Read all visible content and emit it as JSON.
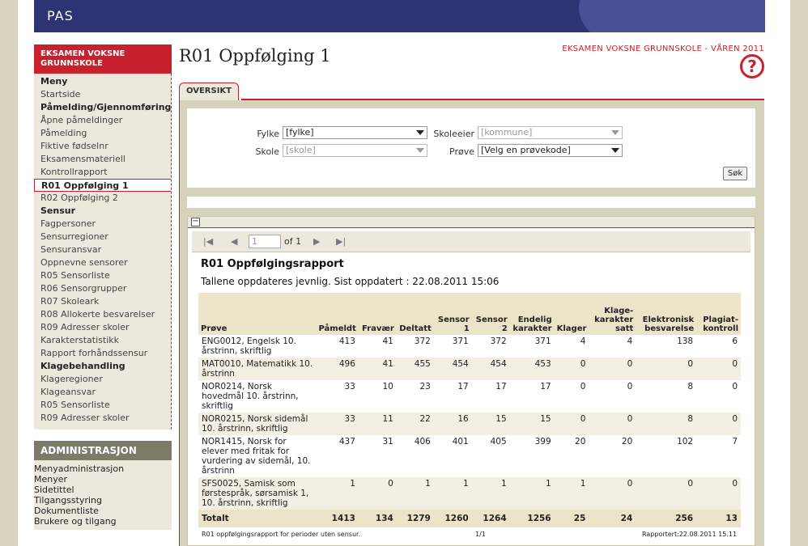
{
  "app": {
    "logo": "PAS"
  },
  "sidebar": {
    "header": "EKSAMEN VOKSNE GRUNNSKOLE",
    "items": [
      {
        "label": "Meny",
        "section": true
      },
      {
        "label": "Startside"
      },
      {
        "label": "Påmelding/Gjennomføring",
        "section": true
      },
      {
        "label": "Åpne påmeldinger"
      },
      {
        "label": "Påmelding"
      },
      {
        "label": "Fiktive fødselnr"
      },
      {
        "label": "Eksamensmateriell"
      },
      {
        "label": "Kontrollrapport"
      },
      {
        "label": "R01 Oppfølging 1",
        "active": true
      },
      {
        "label": "R02 Oppfølging 2"
      },
      {
        "label": "Sensur",
        "section": true
      },
      {
        "label": "Fagpersoner"
      },
      {
        "label": "Sensurregioner"
      },
      {
        "label": "Sensuransvar"
      },
      {
        "label": "Oppnevne sensorer"
      },
      {
        "label": "R05 Sensorliste"
      },
      {
        "label": "R06 Sensorgrupper"
      },
      {
        "label": "R07 Skoleark"
      },
      {
        "label": "R08 Allokerte besvarelser"
      },
      {
        "label": "R09 Adresser skoler"
      },
      {
        "label": "Karakterstatistikk"
      },
      {
        "label": "Rapport forhåndssensur"
      },
      {
        "label": "Klagebehandling",
        "section": true
      },
      {
        "label": "Klageregioner"
      },
      {
        "label": "Klageansvar"
      },
      {
        "label": "R05 Sensorliste"
      },
      {
        "label": "R09 Adresser skoler"
      }
    ],
    "admin_header": "ADMINISTRASJON",
    "admin_items": [
      {
        "label": "Menyadministrasjon",
        "section": true
      },
      {
        "label": "Menyer"
      },
      {
        "label": "Sidetittel"
      },
      {
        "label": "Tilgangsstyring"
      },
      {
        "label": "Dokumentliste"
      },
      {
        "label": "Brukere og tilgang",
        "section": true
      }
    ]
  },
  "page": {
    "title": "R01 Oppfølging 1",
    "exam_label": "EKSAMEN VOKSNE GRUNNSKOLE - VÅREN 2011",
    "help": "?",
    "tab": "OVERSIKT"
  },
  "filters": {
    "fylke_label": "Fylke",
    "fylke_value": "[fylke]",
    "skoleeier_label": "Skoleeier",
    "skoleeier_value": "[kommune]",
    "skole_label": "Skole",
    "skole_value": "[skole]",
    "prove_label": "Prøve",
    "prove_value": "[Velg en prøvekode]",
    "search_button": "Søk"
  },
  "report_toolbar": {
    "first": "|◀",
    "prev": "◀",
    "page_value": "1",
    "of_label": "of 1",
    "next": "▶",
    "last": "▶|",
    "collapse": "−"
  },
  "report": {
    "title": "R01 Oppfølgingsrapport",
    "subtitle": "Tallene oppdateres jevnlig. Sist oppdatert : 22.08.2011 15:06",
    "columns": [
      "Prøve",
      "Påmeldt",
      "Fravær",
      "Deltatt",
      "Sensor 1",
      "Sensor 2",
      "Endelig karakter",
      "Klager",
      "Klage-karakter satt",
      "Elektronisk besvarelse",
      "Plagiat-kontroll"
    ],
    "rows": [
      [
        "ENG0012, Engelsk 10. årstrinn, skriftlig",
        "413",
        "41",
        "372",
        "371",
        "372",
        "371",
        "4",
        "4",
        "138",
        "6"
      ],
      [
        "MAT0010, Matematikk 10. årstrinn",
        "496",
        "41",
        "455",
        "454",
        "454",
        "453",
        "0",
        "0",
        "0",
        "0"
      ],
      [
        "NOR0214, Norsk hovedmål 10. årstrinn, skriftlig",
        "33",
        "10",
        "23",
        "17",
        "17",
        "17",
        "0",
        "0",
        "8",
        "0"
      ],
      [
        "NOR0215, Norsk sidemål 10. årstrinn, skriftlig",
        "33",
        "11",
        "22",
        "16",
        "15",
        "15",
        "0",
        "0",
        "8",
        "0"
      ],
      [
        "NOR1415, Norsk for elever med fritak for vurdering av sidemål, 10. årstrinn",
        "437",
        "31",
        "406",
        "401",
        "405",
        "399",
        "20",
        "20",
        "102",
        "7"
      ],
      [
        "SFS0025, Samisk som førstespråk, sørsamisk 1, 10. årstrinn, skriftlig",
        "1",
        "0",
        "1",
        "1",
        "1",
        "1",
        "1",
        "0",
        "0",
        "0"
      ]
    ],
    "total": [
      "Totalt",
      "1413",
      "134",
      "1279",
      "1260",
      "1264",
      "1256",
      "25",
      "24",
      "256",
      "13"
    ],
    "footer_left": "R01 oppfølgingsrapport for perioder uten sensur.",
    "footer_center": "1/1",
    "footer_right": "Rapportert:22.08.2011 15.11"
  }
}
